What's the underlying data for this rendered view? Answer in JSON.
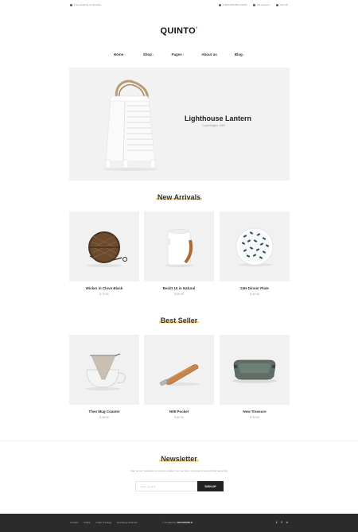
{
  "topbar": {
    "left": [
      {
        "icon": "truck-icon",
        "text": "Free shipping on all order"
      }
    ],
    "right": [
      {
        "icon": "phone-icon",
        "text": "1-800-PRO-BUY-NOW"
      },
      {
        "icon": "user-icon",
        "text": "My Account"
      },
      {
        "icon": "cart-icon",
        "text": "Cart (0)"
      }
    ]
  },
  "logo": {
    "text": "QUINTO"
  },
  "nav": [
    {
      "label": "Home"
    },
    {
      "label": "Shop"
    },
    {
      "label": "Pages"
    },
    {
      "label": "About us"
    },
    {
      "label": "Blog"
    }
  ],
  "hero": {
    "title": "Lighthouse Lantern",
    "subtitle": "Copenhagen / €69",
    "image_icon": "lantern-icon"
  },
  "new_arrivals": {
    "title": "New Arrivals",
    "products": [
      {
        "name": "Wicker in Clove Black",
        "price": "$ 79.00",
        "icon": "wicker-bag-icon"
      },
      {
        "name": "Besitt 15 in Natural",
        "price": "$ 29.00",
        "icon": "ceramic-jar-icon"
      },
      {
        "name": "24H Dinner Plate",
        "price": "$ 42.00",
        "icon": "plate-icon"
      }
    ]
  },
  "best_seller": {
    "title": "Best Seller",
    "products": [
      {
        "name": "Theo Mug Coaster",
        "price": "$ 38.00",
        "icon": "pour-over-icon"
      },
      {
        "name": "N08 Pocket",
        "price": "$ 80.00",
        "icon": "pocket-knife-icon"
      },
      {
        "name": "New Treasure",
        "price": "$ 92.00",
        "icon": "felt-tray-icon"
      }
    ]
  },
  "newsletter": {
    "title": "Newsletter",
    "description": "Sign up our newsletter to receive updates from our store, promotions and exciting upcoming",
    "placeholder": "Enter email id",
    "button": "SIGN UP"
  },
  "footer": {
    "links": [
      "Contact",
      "FAQS",
      "Order Tracking",
      "Exchange & Return"
    ],
    "credit_prefix": "© Created by",
    "credit_brand": "NOVAWORLD",
    "social": [
      {
        "icon": "twitter-icon",
        "glyph": "t"
      },
      {
        "icon": "facebook-icon",
        "glyph": "f"
      },
      {
        "icon": "vimeo-icon",
        "glyph": "v"
      }
    ]
  },
  "colors": {
    "accent": "#f3d27a",
    "dark": "#222222",
    "footer": "#2b2b2b",
    "card_bg": "#f1f1f1"
  }
}
